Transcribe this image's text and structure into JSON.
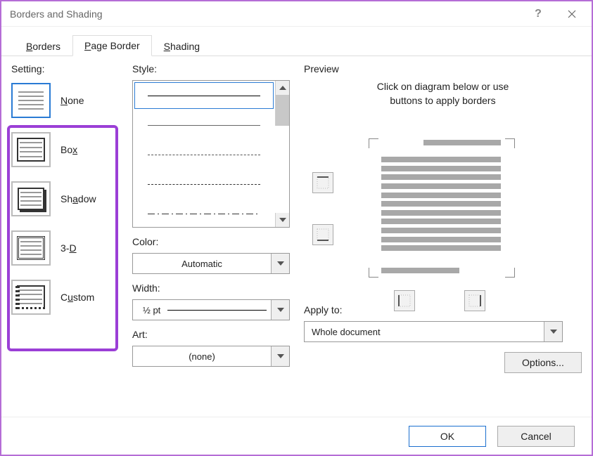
{
  "window": {
    "title": "Borders and Shading"
  },
  "tabs": {
    "borders": "Borders",
    "page_border": "Page Border",
    "shading": "Shading",
    "borders_accel": "B",
    "page_border_accel": "P",
    "shading_accel": "S"
  },
  "setting": {
    "label": "Setting:",
    "items": [
      {
        "label": "None",
        "accel": "N"
      },
      {
        "label": "Box",
        "accel": "x"
      },
      {
        "label": "Shadow",
        "accel": "a"
      },
      {
        "label": "3-D",
        "accel": "D"
      },
      {
        "label": "Custom",
        "accel": "u"
      }
    ]
  },
  "style": {
    "label": "Style:",
    "color_label": "Color:",
    "color_value": "Automatic",
    "width_label": "Width:",
    "width_value": "½ pt",
    "art_label": "Art:",
    "art_value": "(none)"
  },
  "preview": {
    "label": "Preview",
    "hint_line1": "Click on diagram below or use",
    "hint_line2": "buttons to apply borders",
    "apply_label": "Apply to:",
    "apply_value": "Whole document",
    "options_label": "Options..."
  },
  "footer": {
    "ok": "OK",
    "cancel": "Cancel"
  }
}
